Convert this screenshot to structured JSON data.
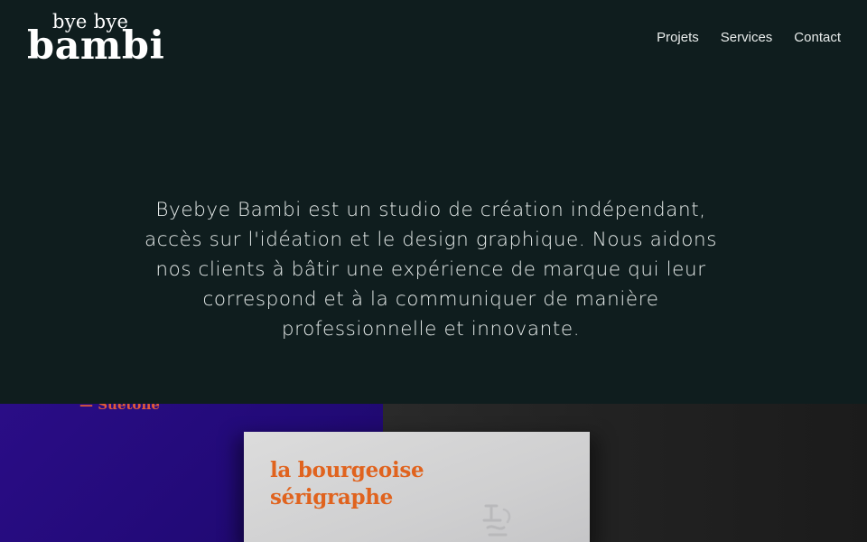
{
  "brand": {
    "logo_small": "bye bye",
    "logo_big": "bambi"
  },
  "nav": {
    "items": [
      {
        "label": "Projets"
      },
      {
        "label": "Services"
      },
      {
        "label": "Contact"
      }
    ]
  },
  "hero": {
    "text": "Byebye Bambi est un studio de création indépendant, accès sur l'idéation et le design graphique. Nous aidons nos clients à bâtir une expérience de marque qui leur correspond et à la communiquer de manière professionnelle et innovante."
  },
  "showcase": {
    "quote_credit": "— Suetone",
    "card_line1": "la bourgeoise",
    "card_line2": "sérigraphe"
  },
  "colors": {
    "background": "#0f1d1e",
    "text": "#e6ebea",
    "blue_panel": "#2a0d86",
    "accent_orange": "#e0631e",
    "accent_red": "#e05a3a"
  }
}
